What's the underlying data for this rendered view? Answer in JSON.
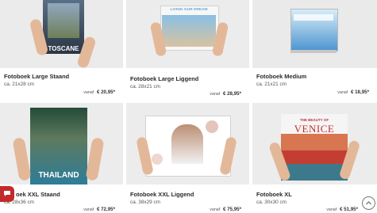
{
  "products": [
    {
      "title": "Fotoboek Large Staand",
      "size": "ca. 21x28 cm",
      "from": "vanaf",
      "price": "€ 20,95*",
      "cover_text": "TOSCANE"
    },
    {
      "title": "Fotoboek Large Liggend",
      "size": "ca. 28x21 cm",
      "from": "vanaf",
      "price": "€ 28,95*",
      "cover_text": "LIVING OUR DREAM"
    },
    {
      "title": "Fotoboek Medium",
      "size": "ca. 21x21 cm",
      "from": "vanaf",
      "price": "€ 18,95*",
      "cover_text": ""
    },
    {
      "title": "oek XXL Staand",
      "size": "ca. 28x36 cm",
      "from": "vanaf",
      "price": "€ 72,95*",
      "cover_text": "THAILAND"
    },
    {
      "title": "Fotoboek XXL Liggend",
      "size": "ca. 38x29 cm",
      "from": "vanaf",
      "price": "€ 75,95*",
      "cover_text": ""
    },
    {
      "title": "Fotoboek XL",
      "size": "ca. 30x30 cm",
      "from": "vanaf",
      "price": "€ 51,95*",
      "cover_text": "VENICE",
      "cover_small": "THE BEAUTY OF"
    }
  ],
  "colors": {
    "accent": "#c42a2a",
    "background": "#ececec"
  },
  "icons": {
    "chat": "chat-icon",
    "scroll_top": "chevron-up-icon"
  }
}
